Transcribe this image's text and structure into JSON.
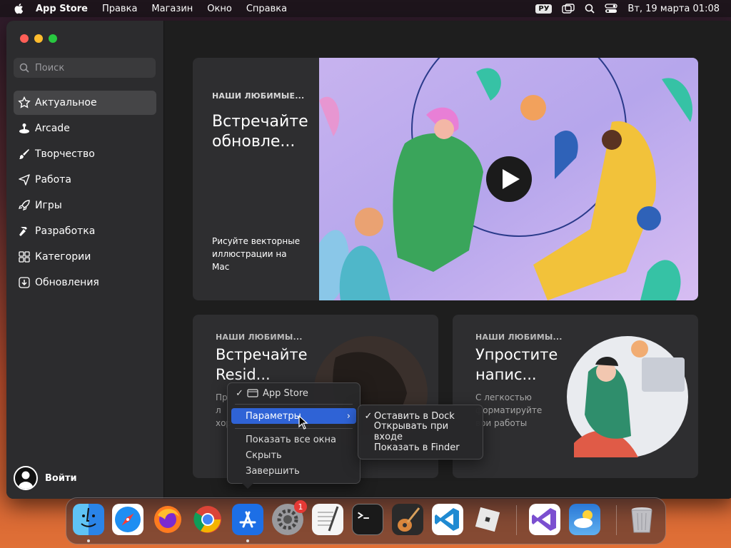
{
  "menubar": {
    "app": "App Store",
    "menus": [
      "Правка",
      "Магазин",
      "Окно",
      "Справка"
    ],
    "input_source": "РУ",
    "datetime": "Вт, 19 марта  01:08"
  },
  "sidebar": {
    "search_placeholder": "Поиск",
    "items": [
      {
        "label": "Актуальное",
        "icon": "star-icon"
      },
      {
        "label": "Arcade",
        "icon": "joystick-icon"
      },
      {
        "label": "Творчество",
        "icon": "brush-icon"
      },
      {
        "label": "Работа",
        "icon": "paper-plane-icon"
      },
      {
        "label": "Игры",
        "icon": "rocket-icon"
      },
      {
        "label": "Разработка",
        "icon": "hammer-icon"
      },
      {
        "label": "Категории",
        "icon": "grid-icon"
      },
      {
        "label": "Обновления",
        "icon": "download-icon"
      }
    ],
    "login_label": "Войти"
  },
  "hero": {
    "eyebrow": "НАШИ ЛЮБИМЫЕ...",
    "title": "Встречайте обновле...",
    "description": "Рисуйте векторные иллюстрации на Mac"
  },
  "cards": [
    {
      "eyebrow": "НАШИ ЛЮБИМЫ...",
      "title": "Встречайте Resid...",
      "description": "Пр\nл\nхор"
    },
    {
      "eyebrow": "НАШИ ЛЮБИМЫ...",
      "title": "Упростите напис...",
      "description": "С легкостью\nформатируйте\nвои работы"
    }
  ],
  "context_menu": {
    "items": [
      "App Store",
      "Параметры",
      "Показать все окна",
      "Скрыть",
      "Завершить"
    ],
    "submenu": [
      "Оставить в Dock",
      "Открывать при входе",
      "Показать в Finder"
    ]
  },
  "dock": {
    "items": [
      "Finder",
      "Safari",
      "Firefox",
      "Chrome",
      "App Store",
      "Системные настройки",
      "TextEdit",
      "Terminal",
      "GarageBand",
      "VS Code",
      "Roblox",
      "Visual Studio",
      "Погода",
      "Корзина"
    ],
    "settings_badge": "1"
  },
  "colors": {
    "accent": "#2f63d6",
    "sidebar": "#2c2c2e",
    "window": "#1e1e1e"
  }
}
